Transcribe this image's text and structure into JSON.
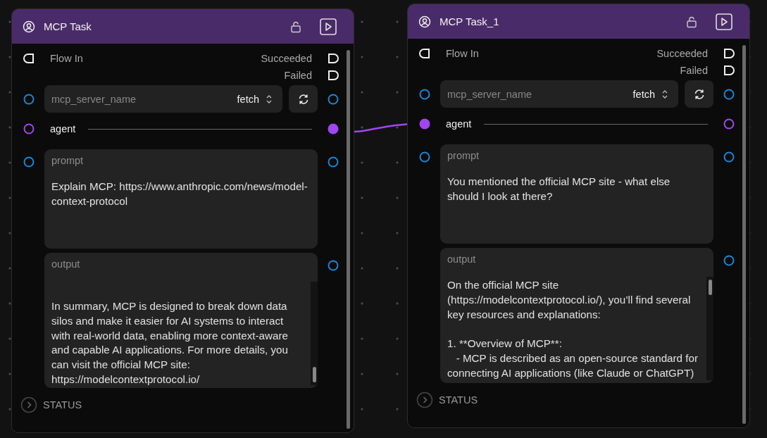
{
  "nodes": [
    {
      "title": "MCP Task",
      "flow_in": "Flow In",
      "outcomes": [
        "Succeeded",
        "Failed"
      ],
      "server": {
        "label": "mcp_server_name",
        "value": "fetch"
      },
      "agent": {
        "label": "agent",
        "in_connected": false,
        "out_connected": true
      },
      "prompt": {
        "label": "prompt",
        "value": "Explain MCP: https://www.anthropic.com/news/model-context-protocol"
      },
      "output": {
        "label": "output",
        "value": "In summary, MCP is designed to break down data silos and make it easier for AI systems to interact with real-world data, enabling more context-aware and capable AI applications. For more details, you can visit the official MCP site: https://modelcontextprotocol.io/",
        "scrolled": true
      },
      "status": "STATUS"
    },
    {
      "title": "MCP Task_1",
      "flow_in": "Flow In",
      "outcomes": [
        "Succeeded",
        "Failed"
      ],
      "server": {
        "label": "mcp_server_name",
        "value": "fetch"
      },
      "agent": {
        "label": "agent",
        "in_connected": true,
        "out_connected": false
      },
      "prompt": {
        "label": "prompt",
        "value": "You mentioned the official MCP site - what else should I look at there?"
      },
      "output": {
        "label": "output",
        "value": "On the official MCP site (https://modelcontextprotocol.io/), you’ll find several key resources and explanations:\n\n1. **Overview of MCP**:\n   - MCP is described as an open-source standard for connecting AI applications (like Claude or ChatGPT)",
        "scrolled": false
      },
      "status": "STATUS"
    }
  ]
}
